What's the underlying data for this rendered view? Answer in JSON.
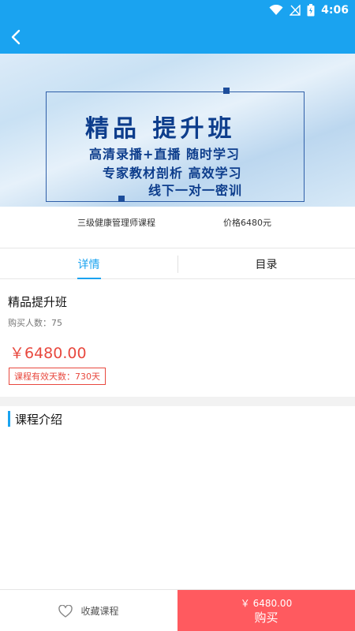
{
  "status_bar": {
    "time": "4:06",
    "icons": [
      "wifi-icon",
      "signal-icon",
      "battery-icon"
    ]
  },
  "app_bar": {
    "back_icon": "chevron-left-icon"
  },
  "banner": {
    "title": "精品 提升班",
    "lines": [
      "高清录播+直播 随时学习",
      "专家教材剖析 高效学习",
      "线下一对一密训"
    ]
  },
  "course_info": {
    "name": "三级健康管理师课程",
    "price": "价格6480元"
  },
  "tabs": [
    {
      "label": "详情",
      "active": true
    },
    {
      "label": "目录",
      "active": false
    }
  ],
  "detail": {
    "title": "精品提升班",
    "buyers": "购买人数：75",
    "price": "￥6480.00",
    "valid_days": "课程有效天数：730天"
  },
  "section": {
    "title": "课程介绍"
  },
  "bottom_bar": {
    "favorite_label": "收藏课程",
    "buy_price": "￥ 6480.00",
    "buy_label": "购买"
  },
  "colors": {
    "primary": "#1aa3f0",
    "price_red": "#e8493f",
    "buy_button": "#ff5a5f"
  }
}
